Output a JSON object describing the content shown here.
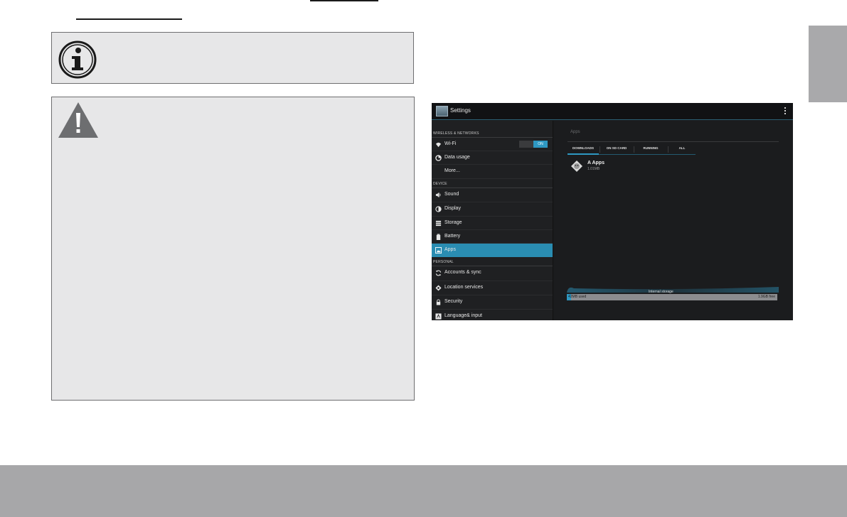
{
  "colors": {
    "box_bg": "#e7e7e8",
    "box_border": "#6e6e70",
    "footer_gray": "#a7a7a9",
    "accent_blue": "#2e98c2",
    "selected_item": "#2a8db2"
  },
  "icons": {
    "note": "info-icon",
    "warning": "warning-icon"
  },
  "screenshot": {
    "actionbar": {
      "title": "Settings"
    },
    "sidebar": {
      "sections": [
        {
          "header": "WIRELESS & NETWORKS",
          "items": [
            {
              "label": "Wi-Fi",
              "icon": "wifi-icon",
              "toggle": "ON"
            },
            {
              "label": "Data usage",
              "icon": "data-usage-icon"
            },
            {
              "label": "More...",
              "icon": ""
            }
          ]
        },
        {
          "header": "DEVICE",
          "items": [
            {
              "label": "Sound",
              "icon": "speaker-icon"
            },
            {
              "label": "Display",
              "icon": "display-icon"
            },
            {
              "label": "Storage",
              "icon": "storage-icon"
            },
            {
              "label": "Battery",
              "icon": "battery-icon"
            },
            {
              "label": "Apps",
              "icon": "apps-icon",
              "selected": true
            }
          ]
        },
        {
          "header": "PERSONAL",
          "items": [
            {
              "label": "Accounts & sync",
              "icon": "sync-icon"
            },
            {
              "label": "Location services",
              "icon": "location-icon"
            },
            {
              "label": "Security",
              "icon": "lock-icon"
            },
            {
              "label": "Language& input",
              "icon": "language-icon"
            }
          ]
        }
      ]
    },
    "content": {
      "title": "Apps",
      "tabs": [
        "DOWNLOADS",
        "ON SD CARD",
        "RUNNING",
        "ALL"
      ],
      "active_tab": "DOWNLOADS",
      "apps": [
        {
          "name": "A Apps",
          "size": "1.01MB",
          "icon": "android-icon"
        }
      ],
      "storage": {
        "label": "Internal storage",
        "used": "42MB used",
        "free": "1.9GB free"
      }
    }
  }
}
